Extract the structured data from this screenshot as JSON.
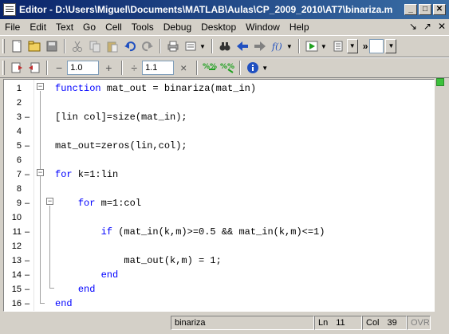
{
  "window": {
    "title": "Editor - D:\\Users\\Miguel\\Documents\\MATLAB\\Aulas\\CP_2009_2010\\AT7\\binariza.m",
    "minimize": "_",
    "maximize": "□",
    "close": "✕"
  },
  "menu": {
    "items": [
      "File",
      "Edit",
      "Text",
      "Go",
      "Cell",
      "Tools",
      "Debug",
      "Desktop",
      "Window",
      "Help"
    ],
    "right_icons": [
      "↘",
      "↗",
      "✕"
    ]
  },
  "toolbar1": {
    "icons": [
      "new-file-icon",
      "open-file-icon",
      "save-icon",
      "cut-icon",
      "copy-icon",
      "paste-icon",
      "undo-icon",
      "redo-icon",
      "print-icon",
      "stack-icon",
      "find-icon",
      "back-icon",
      "forward-icon",
      "function-icon",
      "run-icon",
      "breakpoint-icon"
    ],
    "more_label": "»"
  },
  "toolbar2": {
    "minus_label": "−",
    "value1": "1.0",
    "plus_label": "+",
    "divide_label": "÷",
    "value2": "1.1",
    "times_label": "×"
  },
  "editor": {
    "lines": [
      {
        "num": "1",
        "dash": "",
        "parts": [
          {
            "t": "function",
            "kw": true
          },
          {
            "t": " mat_out = binariza(mat_in)"
          }
        ]
      },
      {
        "num": "2",
        "dash": "",
        "parts": []
      },
      {
        "num": "3",
        "dash": "–",
        "parts": [
          {
            "t": "[lin col]=size(mat_in);"
          }
        ]
      },
      {
        "num": "4",
        "dash": "",
        "parts": []
      },
      {
        "num": "5",
        "dash": "–",
        "parts": [
          {
            "t": "mat_out=zeros(lin,col);"
          }
        ]
      },
      {
        "num": "6",
        "dash": "",
        "parts": []
      },
      {
        "num": "7",
        "dash": "–",
        "parts": [
          {
            "t": "for",
            "kw": true
          },
          {
            "t": " k=1:lin"
          }
        ]
      },
      {
        "num": "8",
        "dash": "",
        "parts": []
      },
      {
        "num": "9",
        "dash": "–",
        "parts": [
          {
            "t": "    "
          },
          {
            "t": "for",
            "kw": true
          },
          {
            "t": " m=1:col"
          }
        ]
      },
      {
        "num": "10",
        "dash": "",
        "parts": []
      },
      {
        "num": "11",
        "dash": "–",
        "parts": [
          {
            "t": "        "
          },
          {
            "t": "if",
            "kw": true
          },
          {
            "t": " (mat_in(k,m)>=0.5 && mat_in(k,m)<=1)"
          }
        ]
      },
      {
        "num": "12",
        "dash": "",
        "parts": []
      },
      {
        "num": "13",
        "dash": "–",
        "parts": [
          {
            "t": "            mat_out(k,m) = 1;"
          }
        ]
      },
      {
        "num": "14",
        "dash": "–",
        "parts": [
          {
            "t": "        "
          },
          {
            "t": "end",
            "kw": true
          }
        ]
      },
      {
        "num": "15",
        "dash": "–",
        "parts": [
          {
            "t": "    "
          },
          {
            "t": "end",
            "kw": true
          }
        ]
      },
      {
        "num": "16",
        "dash": "–",
        "parts": [
          {
            "t": "end",
            "kw": true
          }
        ]
      }
    ]
  },
  "status": {
    "file": "binariza",
    "ln_label": "Ln",
    "ln": "11",
    "col_label": "Col",
    "col": "39",
    "ovr": "OVR"
  }
}
